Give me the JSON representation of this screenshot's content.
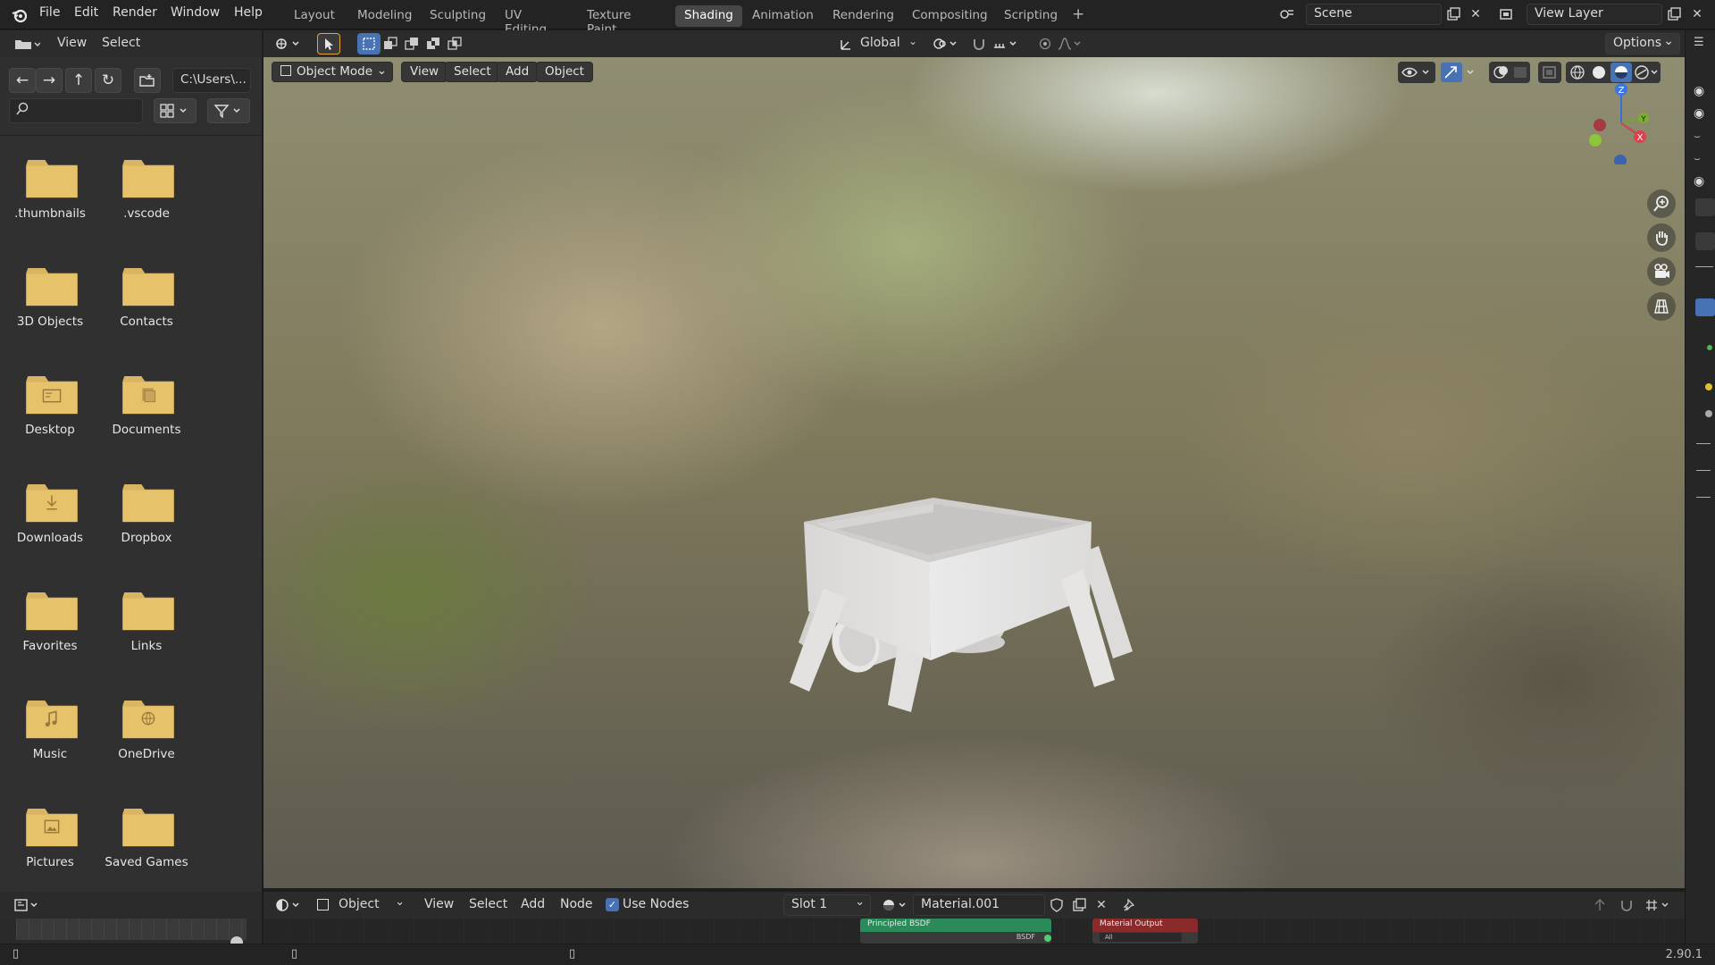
{
  "app": {
    "version": "2.90.1"
  },
  "menu": [
    "File",
    "Edit",
    "Render",
    "Window",
    "Help"
  ],
  "workspace_tabs": [
    {
      "label": "Layout",
      "active": false
    },
    {
      "label": "Modeling",
      "active": false
    },
    {
      "label": "Sculpting",
      "active": false
    },
    {
      "label": "UV Editing",
      "active": false
    },
    {
      "label": "Texture Paint",
      "active": false
    },
    {
      "label": "Shading",
      "active": true
    },
    {
      "label": "Animation",
      "active": false
    },
    {
      "label": "Rendering",
      "active": false
    },
    {
      "label": "Compositing",
      "active": false
    },
    {
      "label": "Scripting",
      "active": false
    }
  ],
  "scene": {
    "name": "Scene"
  },
  "view_layer": {
    "name": "View Layer"
  },
  "file_browser": {
    "header": {
      "view": "View",
      "select": "Select"
    },
    "path": "C:\\Users\\...",
    "search": {
      "placeholder": ""
    },
    "folders": [
      {
        "label": ".thumbnails",
        "icon": "folder-icon"
      },
      {
        "label": ".vscode",
        "icon": "folder-icon"
      },
      {
        "label": "3D Objects",
        "icon": "folder-icon"
      },
      {
        "label": "Contacts",
        "icon": "folder-icon"
      },
      {
        "label": "Desktop",
        "icon": "desktop-folder-icon"
      },
      {
        "label": "Documents",
        "icon": "documents-folder-icon"
      },
      {
        "label": "Downloads",
        "icon": "downloads-folder-icon"
      },
      {
        "label": "Dropbox",
        "icon": "folder-icon"
      },
      {
        "label": "Favorites",
        "icon": "folder-icon"
      },
      {
        "label": "Links",
        "icon": "folder-icon"
      },
      {
        "label": "Music",
        "icon": "music-folder-icon"
      },
      {
        "label": "OneDrive",
        "icon": "onedrive-folder-icon"
      },
      {
        "label": "Pictures",
        "icon": "pictures-folder-icon"
      },
      {
        "label": "Saved Games",
        "icon": "folder-icon"
      }
    ]
  },
  "viewport_header": {
    "transform_orientation": "Global",
    "options": "Options"
  },
  "viewport_toolbar": {
    "mode": "Object Mode",
    "view": "View",
    "select": "Select",
    "add": "Add",
    "object": "Object"
  },
  "gizmo": {
    "z": "Z",
    "y": "Y",
    "x": "X"
  },
  "node_editor": {
    "type": "Object",
    "view": "View",
    "select": "Select",
    "add": "Add",
    "node": "Node",
    "use_nodes_label": "Use Nodes",
    "use_nodes": true,
    "slot": "Slot 1",
    "material": "Material.001",
    "nodes": [
      {
        "title": "Principled BSDF",
        "color": "#2a8a5a",
        "socket": "BSDF"
      },
      {
        "title": "Material Output",
        "color": "#8a2a2a",
        "socket": "All"
      }
    ]
  },
  "colors": {
    "accent": "#4772b3",
    "folder": "#e6c26a",
    "active_tab": "#474747"
  }
}
